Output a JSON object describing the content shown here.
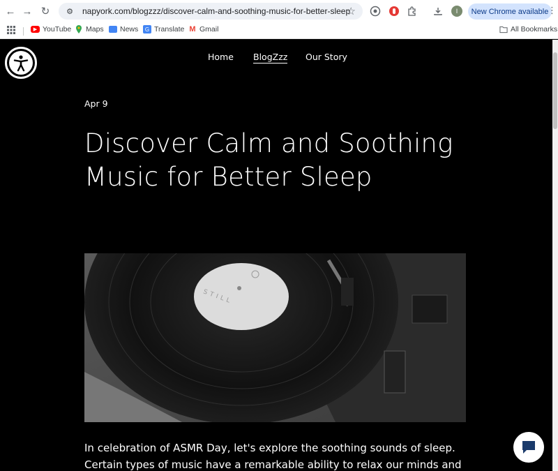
{
  "browser": {
    "url": "napyork.com/blogzzz/discover-calm-and-soothing-music-for-better-sleep",
    "update_label": "New Chrome available",
    "profile_initial": "I",
    "bookmarks": [
      {
        "label": "YouTube",
        "icon": "youtube-icon",
        "color": "#ff0000"
      },
      {
        "label": "Maps",
        "icon": "maps-icon",
        "color": "#34a853"
      },
      {
        "label": "News",
        "icon": "news-icon",
        "color": "#4285f4"
      },
      {
        "label": "Translate",
        "icon": "translate-icon",
        "color": "#4285f4"
      },
      {
        "label": "Gmail",
        "icon": "gmail-icon",
        "color": "#ea4335"
      }
    ],
    "all_bookmarks": "All Bookmarks"
  },
  "site": {
    "nav": [
      {
        "label": "Home",
        "active": false
      },
      {
        "label": "BlogZzz",
        "active": true
      },
      {
        "label": "Our Story",
        "active": false
      }
    ]
  },
  "post": {
    "date": "Apr 9",
    "title": "Discover Calm and Soothing Music for Better Sleep",
    "record_label_text": "STILL",
    "body": "In celebration of ASMR Day, let's explore the soothing sounds of sleep. Certain types of music have a remarkable ability to relax our minds and"
  },
  "colors": {
    "page_bg": "#000000",
    "text": "#ffffff",
    "update_pill": "#d3e3fd"
  }
}
